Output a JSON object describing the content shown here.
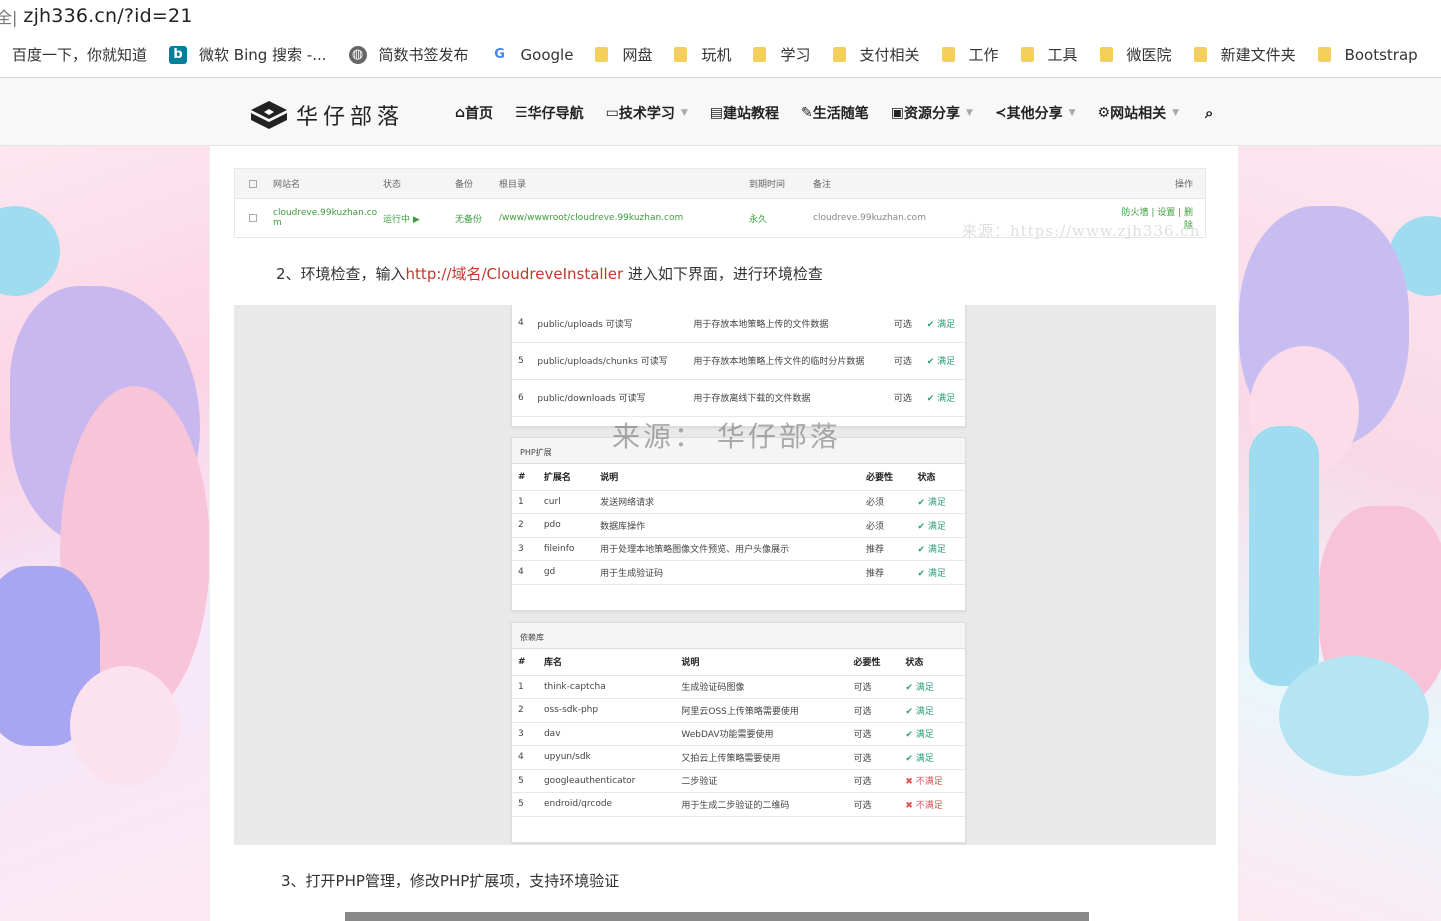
{
  "browser": {
    "url": "zjh336.cn/?id=21",
    "bookmarks": [
      {
        "label": "百度一下，你就知道",
        "type": "plain"
      },
      {
        "label": "微软 Bing 搜索 -...",
        "type": "bing"
      },
      {
        "label": "简数书签发布",
        "type": "globe"
      },
      {
        "label": "Google",
        "type": "google"
      },
      {
        "label": "网盘",
        "type": "folder"
      },
      {
        "label": "玩机",
        "type": "folder"
      },
      {
        "label": "学习",
        "type": "folder"
      },
      {
        "label": "支付相关",
        "type": "folder"
      },
      {
        "label": "工作",
        "type": "folder"
      },
      {
        "label": "工具",
        "type": "folder"
      },
      {
        "label": "微医院",
        "type": "folder"
      },
      {
        "label": "新建文件夹",
        "type": "folder"
      },
      {
        "label": "Bootstrap",
        "type": "folder"
      }
    ]
  },
  "site": {
    "logo_text": "华仔部落",
    "nav": [
      {
        "icon": "home-icon",
        "glyph": "⌂",
        "label": "首页",
        "caret": false
      },
      {
        "icon": "list-icon",
        "glyph": "☰",
        "label": "华仔导航",
        "caret": false
      },
      {
        "icon": "monitor-icon",
        "glyph": "▭",
        "label": "技术学习",
        "caret": true
      },
      {
        "icon": "book-icon",
        "glyph": "▤",
        "label": "建站教程",
        "caret": false
      },
      {
        "icon": "pencil-icon",
        "glyph": "✎",
        "label": "生活随笔",
        "caret": false
      },
      {
        "icon": "resource-icon",
        "glyph": "▣",
        "label": "资源分享",
        "caret": true
      },
      {
        "icon": "share-icon",
        "glyph": "≺",
        "label": "其他分享",
        "caret": true
      },
      {
        "icon": "gear-icon",
        "glyph": "⚙",
        "label": "网站相关",
        "caret": true
      }
    ]
  },
  "article": {
    "site_table": {
      "headers": [
        "网站名",
        "状态",
        "备份",
        "根目录",
        "到期时间",
        "备注",
        "操作"
      ],
      "row": {
        "name": "cloudreve.99kuzhan.com",
        "status": "运行中 ▶",
        "backup": "无备份",
        "root": "/www/wwwroot/cloudreve.99kuzhan.com",
        "expire": "永久",
        "note": "cloudreve.99kuzhan.com",
        "actions": "防火墙 | 设置 | 删除"
      }
    },
    "watermark_url": "来源：https://www.zjh336.cn",
    "step2_prefix": "2、环境检查，输入",
    "step2_link": "http://域名/CloudreveInstaller",
    "step2_suffix": " 进入如下界面，进行环境检查",
    "watermark_main": "来源：  华仔部落",
    "dir_rows": [
      {
        "n": "4",
        "path": "public/uploads 可读写",
        "desc": "用于存放本地策略上传的文件数据",
        "need": "可选",
        "state": "满足"
      },
      {
        "n": "5",
        "path": "public/uploads/chunks 可读写",
        "desc": "用于存放本地策略上传文件的临时分片数据",
        "need": "可选",
        "state": "满足"
      },
      {
        "n": "6",
        "path": "public/downloads 可读写",
        "desc": "用于存放离线下载的文件数据",
        "need": "可选",
        "state": "满足"
      }
    ],
    "php_panel": {
      "title": "PHP扩展",
      "headers": [
        "#",
        "扩展名",
        "说明",
        "必要性",
        "状态"
      ],
      "rows": [
        {
          "n": "1",
          "name": "curl",
          "desc": "发送网络请求",
          "need": "必须",
          "state": "满足"
        },
        {
          "n": "2",
          "name": "pdo",
          "desc": "数据库操作",
          "need": "必须",
          "state": "满足"
        },
        {
          "n": "3",
          "name": "fileinfo",
          "desc": "用于处理本地策略图像文件预览、用户头像展示",
          "need": "推荐",
          "state": "满足"
        },
        {
          "n": "4",
          "name": "gd",
          "desc": "用于生成验证码",
          "need": "推荐",
          "state": "满足"
        }
      ]
    },
    "lib_panel": {
      "title": "依赖库",
      "headers": [
        "#",
        "库名",
        "说明",
        "必要性",
        "状态"
      ],
      "rows": [
        {
          "n": "1",
          "name": "think-captcha",
          "desc": "生成验证码图像",
          "need": "可选",
          "state": "满足",
          "ok": true
        },
        {
          "n": "2",
          "name": "oss-sdk-php",
          "desc": "阿里云OSS上传策略需要使用",
          "need": "可选",
          "state": "满足",
          "ok": true
        },
        {
          "n": "3",
          "name": "dav",
          "desc": "WebDAV功能需要使用",
          "need": "可选",
          "state": "满足",
          "ok": true
        },
        {
          "n": "4",
          "name": "upyun/sdk",
          "desc": "又拍云上传策略需要使用",
          "need": "可选",
          "state": "满足",
          "ok": true
        },
        {
          "n": "5",
          "name": "googleauthenticator",
          "desc": "二步验证",
          "need": "可选",
          "state": "不满足",
          "ok": false
        },
        {
          "n": "5",
          "name": "endroid/qrcode",
          "desc": "用于生成二步验证的二维码",
          "need": "可选",
          "state": "不满足",
          "ok": false
        }
      ]
    },
    "step3": "3、打开PHP管理，修改PHP扩展项，支持环境验证"
  }
}
